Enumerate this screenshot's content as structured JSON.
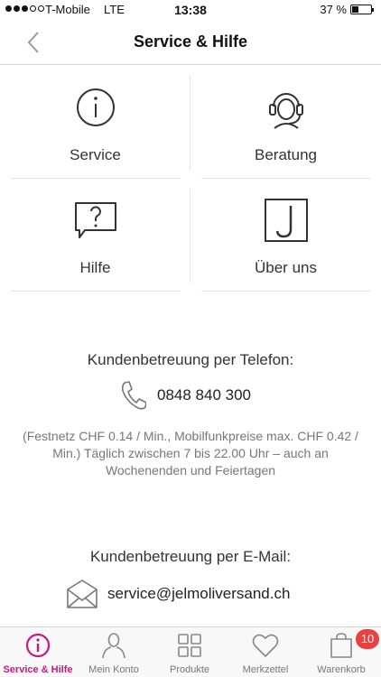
{
  "status_bar": {
    "carrier": "T-Mobile",
    "network": "LTE",
    "time": "13:38",
    "battery_percent": "37 %",
    "battery_level": 0.37
  },
  "nav": {
    "title": "Service & Hilfe",
    "back_icon": "chevron-left-icon"
  },
  "grid": {
    "tiles": [
      {
        "label": "Service",
        "icon": "info-circle-icon"
      },
      {
        "label": "Beratung",
        "icon": "headset-icon"
      },
      {
        "label": "Hilfe",
        "icon": "question-bubble-icon"
      },
      {
        "label": "Über uns",
        "icon": "j-logo-icon"
      }
    ]
  },
  "contact": {
    "phone_heading": "Kundenbetreuung per Telefon:",
    "phone_number": "0848 840 300",
    "phone_note": "(Festnetz CHF 0.14 / Min., Mobilfunkpreise max. CHF 0.42 / Min.) Täglich zwischen 7 bis 22.00 Uhr – auch an Wochenenden und Feiertagen",
    "email_heading": "Kundenbetreuung per E-Mail:",
    "email_address": "service@jelmoliversand.ch"
  },
  "tab_bar": {
    "tabs": [
      {
        "label": "Service & Hilfe",
        "icon": "info-circle-icon",
        "active": true
      },
      {
        "label": "Mein Konto",
        "icon": "person-icon",
        "active": false
      },
      {
        "label": "Produkte",
        "icon": "grid-icon",
        "active": false
      },
      {
        "label": "Merkzettel",
        "icon": "heart-icon",
        "active": false
      },
      {
        "label": "Warenkorb",
        "icon": "shopping-bag-icon",
        "active": false
      }
    ],
    "cart_badge": "10"
  },
  "colors": {
    "accent": "#c8197f",
    "badge": "#e94040"
  }
}
